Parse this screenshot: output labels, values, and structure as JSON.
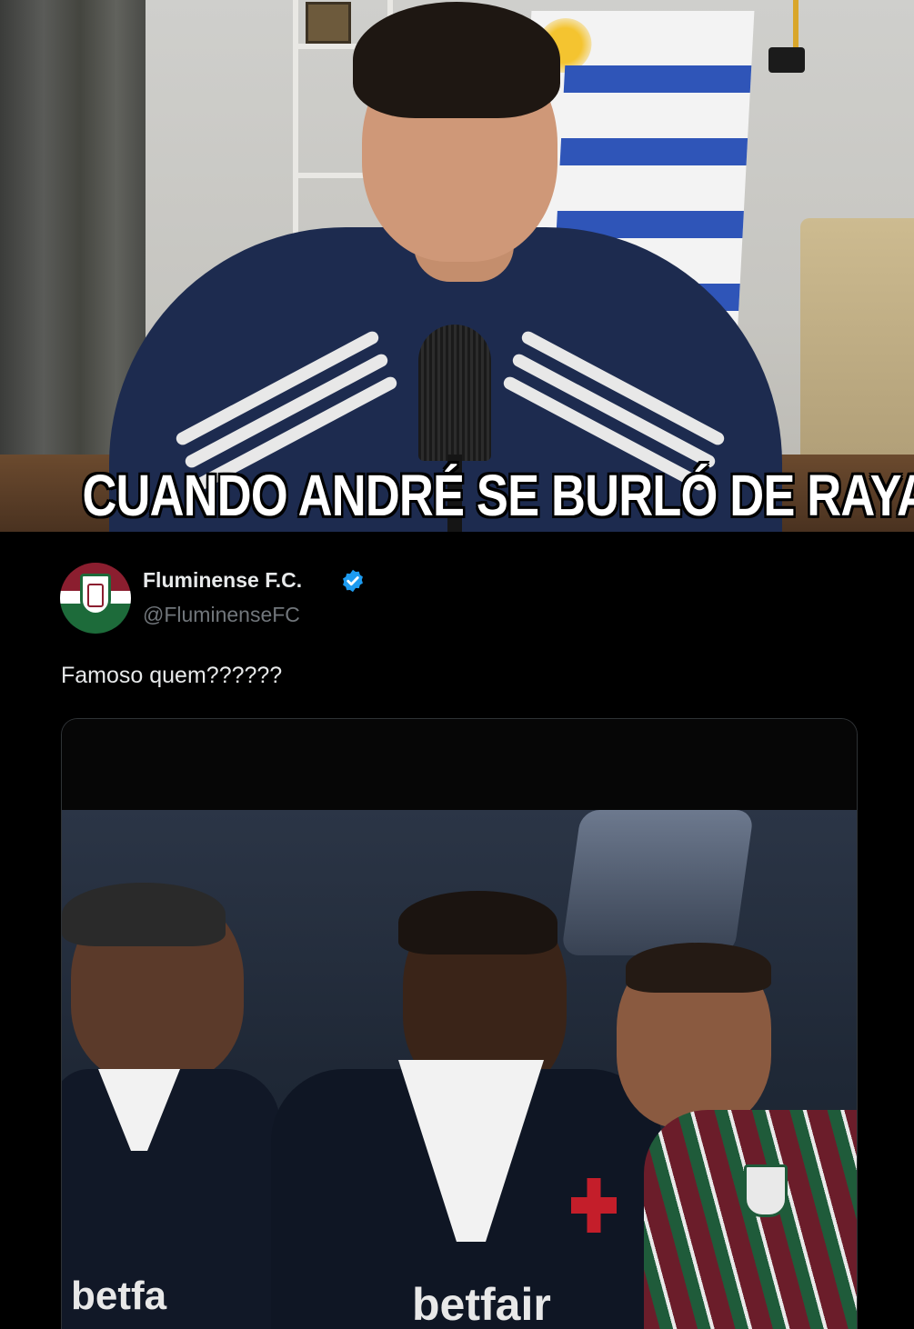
{
  "video_caption": "CUANDO ANDRÉ SE BURLÓ DE RAYAN",
  "tweet": {
    "author_name": "Fluminense F.C.",
    "author_handle": "@FluminenseFC",
    "verified_icon": "verified-badge-icon",
    "text": "Famoso quem??????",
    "media_type": "video"
  },
  "jersey_text": {
    "sponsor_left": "betfa",
    "sponsor_center": "betfair"
  },
  "colors": {
    "background": "#000000",
    "primary_text": "#e7e9ea",
    "secondary_text": "#71767b",
    "verified_blue": "#1d9bf0",
    "media_border": "#2f3336",
    "fluminense_garnet": "#8b1e2f",
    "fluminense_green": "#1d6b3a"
  }
}
